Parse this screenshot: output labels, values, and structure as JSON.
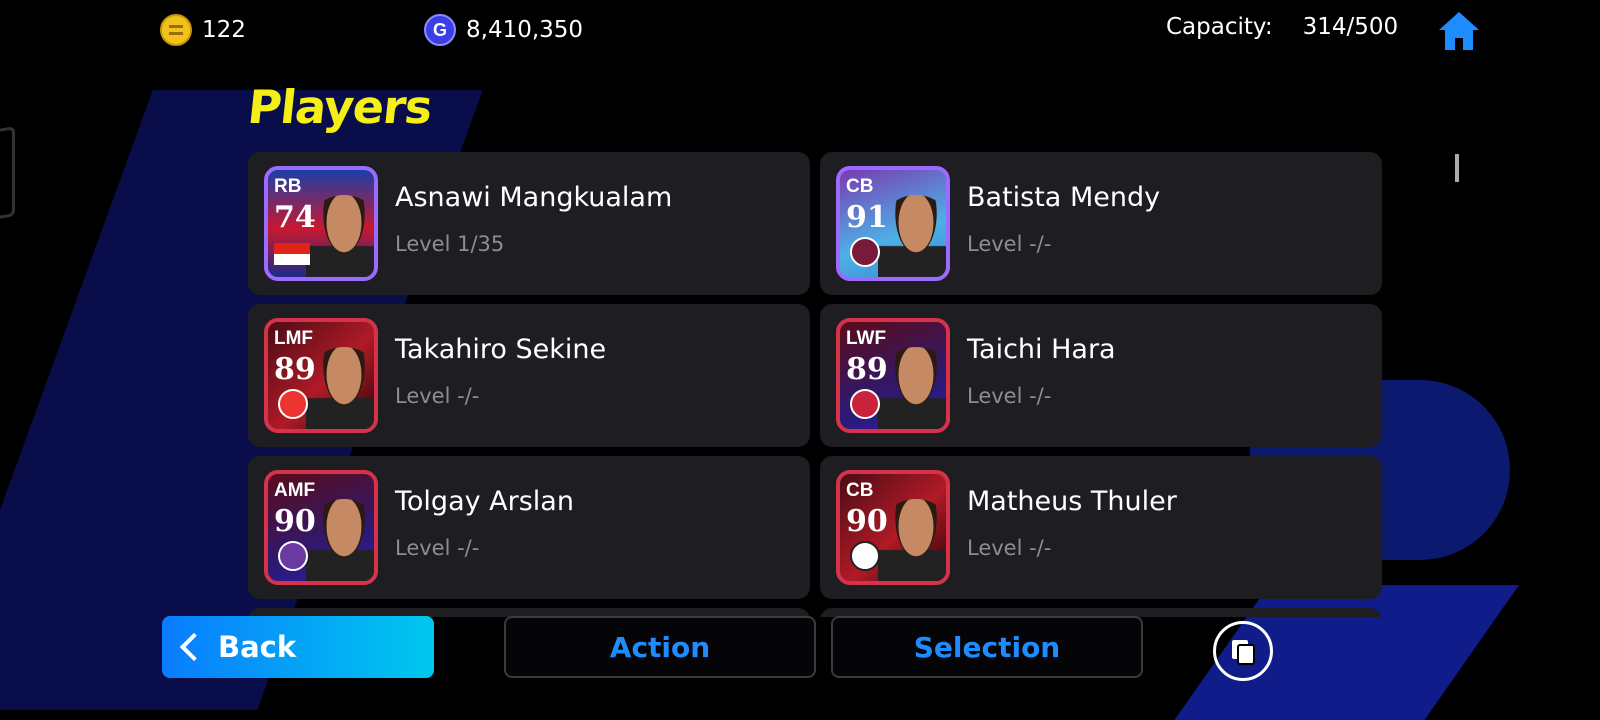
{
  "currency": {
    "coins": "122",
    "gp": "8,410,350",
    "gp_symbol": "G"
  },
  "capacity": {
    "label": "Capacity:",
    "value": "314/500"
  },
  "page_title": "Players",
  "players": [
    {
      "position": "RB",
      "rating": "74",
      "name": "Asnawi Mangkualam",
      "level": "Level 1/35"
    },
    {
      "position": "CB",
      "rating": "91",
      "name": "Batista Mendy",
      "level": "Level -/-"
    },
    {
      "position": "LMF",
      "rating": "89",
      "name": "Takahiro Sekine",
      "level": "Level -/-"
    },
    {
      "position": "LWF",
      "rating": "89",
      "name": "Taichi Hara",
      "level": "Level -/-"
    },
    {
      "position": "AMF",
      "rating": "90",
      "name": "Tolgay Arslan",
      "level": "Level -/-"
    },
    {
      "position": "CB",
      "rating": "90",
      "name": "Matheus Thuler",
      "level": "Level -/-"
    }
  ],
  "bottom_bar": {
    "back_label": "Back",
    "action_label": "Action",
    "selection_label": "Selection"
  },
  "icons": {
    "coin": "coin-icon",
    "gp": "gp-icon",
    "home": "home-icon",
    "back": "chevron-left-icon",
    "copy": "copy-icon"
  },
  "colors": {
    "title": "#f4f016",
    "accent_blue": "#1e8bff",
    "card_red": "#d6324a",
    "card_violet": "#9b6bff"
  }
}
